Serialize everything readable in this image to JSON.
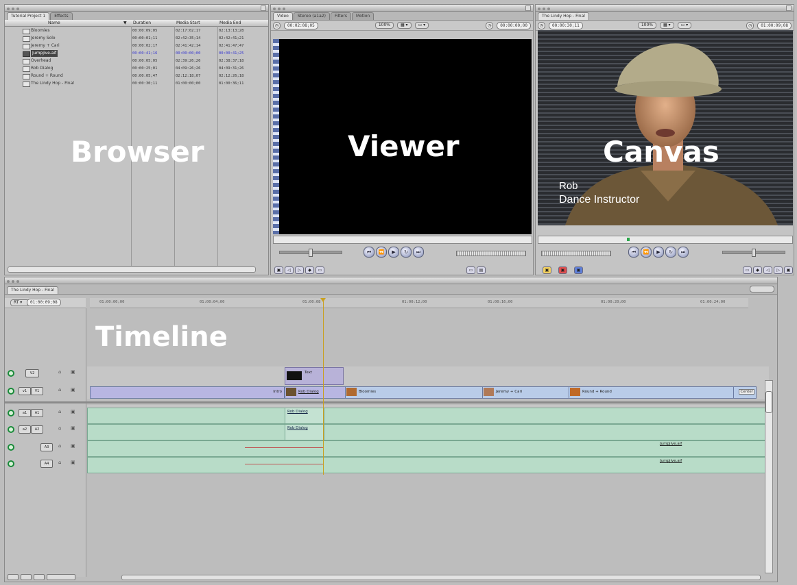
{
  "browser": {
    "tabs": [
      "Tutorial Project 1",
      "Effects"
    ],
    "columns": [
      "Name",
      "Duration",
      "Media Start",
      "Media End"
    ],
    "rows": [
      {
        "name": "Bloomies",
        "duration": "00:00:09;05",
        "media_start": "02:17:02;17",
        "media_end": "02:13:13;28"
      },
      {
        "name": "Jeremy Solo",
        "duration": "00:00:01;11",
        "media_start": "02:42:35;14",
        "media_end": "02:42:41;21"
      },
      {
        "name": "Jeremy + Cari",
        "duration": "00:00:02;17",
        "media_start": "02:41:42;14",
        "media_end": "02:41:47;47"
      },
      {
        "name": "Jumpjive.aif",
        "duration": "00:00:41;16",
        "media_start": "00:00:00;00",
        "media_end": "00:00:41;25",
        "selected": true
      },
      {
        "name": "Overhead",
        "duration": "00:00:05;05",
        "media_start": "02:39:26;26",
        "media_end": "02:38:37;18"
      },
      {
        "name": "Rob Dialog",
        "duration": "00:00:25;01",
        "media_start": "04:09:26;26",
        "media_end": "04:09:31;26"
      },
      {
        "name": "Round + Round",
        "duration": "00:00:05;47",
        "media_start": "02:12:18;07",
        "media_end": "02:12:26;18"
      },
      {
        "name": "The Lindy Hop - Final",
        "duration": "00:00:30;11",
        "media_start": "01:00:00;00",
        "media_end": "01:00:36;11"
      }
    ],
    "big_label": "Browser"
  },
  "viewer": {
    "tabs": [
      "Video",
      "Stereo (a1a2)",
      "Filters",
      "Motion"
    ],
    "timecode_left": "00:02:08;05",
    "zoom": "100%",
    "timecode_right": "00:00:00;00",
    "big_label": "Viewer"
  },
  "canvas": {
    "tabs": [
      "The Lindy Hop - Final"
    ],
    "timecode_left": "00:00:30;11",
    "zoom": "100%",
    "timecode_right": "01:00:09;08",
    "big_label": "Canvas",
    "lower_third_name": "Rob",
    "lower_third_title": "Dance Instructor"
  },
  "timeline": {
    "tab": "The Lindy Hop - Final",
    "current_timecode": "01:00:09;08",
    "ruler_ticks": [
      "01:00:00;00",
      "01:00:04;00",
      "01:00:08",
      "01:00:12;00",
      "01:00:16;00",
      "01:00:20;00",
      "01:00:24;00"
    ],
    "big_label": "Timeline",
    "tracks": [
      {
        "label": "V2"
      },
      {
        "label": "V1",
        "source": "v1"
      },
      {
        "label": "A1",
        "source": "a1"
      },
      {
        "label": "A2",
        "source": "a2"
      },
      {
        "label": "A3"
      },
      {
        "label": "A4"
      }
    ],
    "v2_clips": [
      {
        "name": "Text"
      }
    ],
    "v1_clips": [
      {
        "name": "Intro"
      },
      {
        "name": "Rob Dialog"
      },
      {
        "name": "Bloomies"
      },
      {
        "name": "Jeremy + Cari"
      },
      {
        "name": "Round + Round"
      },
      {
        "name": "Center"
      }
    ],
    "a_clips": [
      {
        "name": "Rob Dialog"
      },
      {
        "name": "Rob Dialog"
      },
      {
        "name": "Jumpjive.aif"
      },
      {
        "name": "Jumpjive.aif"
      }
    ]
  },
  "colors": {
    "video_clip": "#b9cce8",
    "audio_clip": "#b8dcc8",
    "playhead": "#c9a020"
  }
}
